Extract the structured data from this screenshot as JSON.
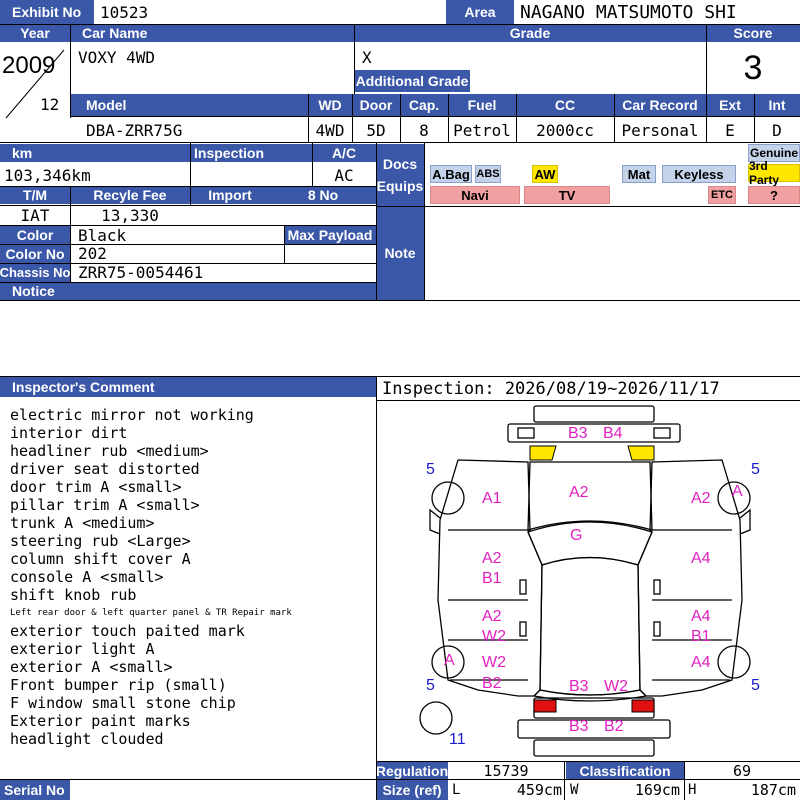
{
  "header": {
    "exhibit_no_label": "Exhibit No",
    "exhibit_no": "10523",
    "area_label": "Area",
    "area": "NAGANO MATSUMOTO SHI"
  },
  "row1": {
    "year_label": "Year",
    "car_name_label": "Car Name",
    "grade_label": "Grade",
    "score_label": "Score",
    "year": "2009",
    "month": "12",
    "car_name": "VOXY 4WD",
    "grade": "X",
    "additional_grade_label": "Additional Grade",
    "score": "3"
  },
  "row2": {
    "model_label": "Model",
    "wd_label": "WD",
    "door_label": "Door",
    "cap_label": "Cap.",
    "fuel_label": "Fuel",
    "cc_label": "CC",
    "car_record_label": "Car Record",
    "ext_label": "Ext",
    "int_label": "Int",
    "model": "DBA-ZRR75G",
    "wd": "4WD",
    "door": "5D",
    "cap": "8",
    "fuel": "Petrol",
    "cc": "2000cc",
    "car_record": "Personal",
    "ext": "E",
    "int": "D"
  },
  "row3": {
    "km_label": "km",
    "inspection_label": "Inspection",
    "ac_label": "A/C",
    "km": "103,346km",
    "ac": "AC",
    "docs_label": "Docs",
    "equips_label": "Equips",
    "genuine_label": "Genuine",
    "third_party_label": "3rd Party"
  },
  "equips": {
    "abag": "A.Bag",
    "abs": "ABS",
    "aw": "AW",
    "mat": "Mat",
    "keyless": "Keyless",
    "navi": "Navi",
    "tv": "TV",
    "etc": "ETC",
    "unknown": "?"
  },
  "row4": {
    "tm_label": "T/M",
    "recycle_label": "Recyle Fee",
    "import_label": "Import",
    "eight_no_label": "8 No",
    "tm": "IAT",
    "recycle": "13,330"
  },
  "row5": {
    "color_label": "Color",
    "color": "Black",
    "max_payload_label": "Max Payload",
    "color_no_label": "Color No",
    "color_no": "202",
    "chassis_label": "Chassis No",
    "chassis": "ZRR75-0054461",
    "notice_label": "Notice",
    "note_label": "Note"
  },
  "inspector": {
    "label": "Inspector's Comment",
    "inspection_period": "Inspection: 2026/08/19~2026/11/17",
    "lines": [
      "electric mirror not working",
      "interior dirt",
      "headliner rub <medium>",
      "driver seat distorted",
      "door trim A <small>",
      "pillar trim A <small>",
      "trunk A <medium>",
      "steering rub <Large>",
      "column shift cover A",
      "console A <small>",
      "shift knob rub",
      "Left rear door & left quarter panel & TR Repair mark",
      "exterior touch paited mark",
      "exterior light A",
      "exterior A <small>",
      "Front bumper rip (small)",
      "F window small stone chip",
      "Exterior paint marks",
      "headlight clouded"
    ]
  },
  "diagram_marks": {
    "b3_top": "B3",
    "b4_top": "B4",
    "left_top_5": "5",
    "right_top_5": "5",
    "a1": "A1",
    "a2_center": "A2",
    "a2_right": "A2",
    "a_right": "A",
    "g": "G",
    "a2_left_mid": "A2",
    "b1_left": "B1",
    "a4_right_mid": "A4",
    "a2_left_lower": "A2",
    "w2_left": "W2",
    "a4_right_lower": "A4",
    "b1_right": "B1",
    "a_left": "A",
    "w2_left_low": "W2",
    "a4_right_low": "A4",
    "b2_left": "B2",
    "left_bottom_5": "5",
    "right_bottom_5": "5",
    "b3_rear": "B3",
    "w2_rear": "W2",
    "b3_bottom": "B3",
    "b2_bottom": "B2",
    "eleven": "11"
  },
  "bottom": {
    "regulation_label": "Regulation",
    "regulation": "15739",
    "classification_label": "Classification",
    "classification": "69",
    "size_label": "Size (ref)",
    "l_label": "L",
    "l": "459cm",
    "w_label": "W",
    "w": "169cm",
    "h_label": "H",
    "h": "187cm",
    "serial_label": "Serial No"
  },
  "colors": {
    "header_blue": "#3a57a8",
    "aw_yellow": "#ffe600",
    "red_badge": "#f0a0a0",
    "blue_badge": "#c5d3ea",
    "mark_magenta": "#e020c0",
    "mark_blue": "#1a1ad0"
  }
}
